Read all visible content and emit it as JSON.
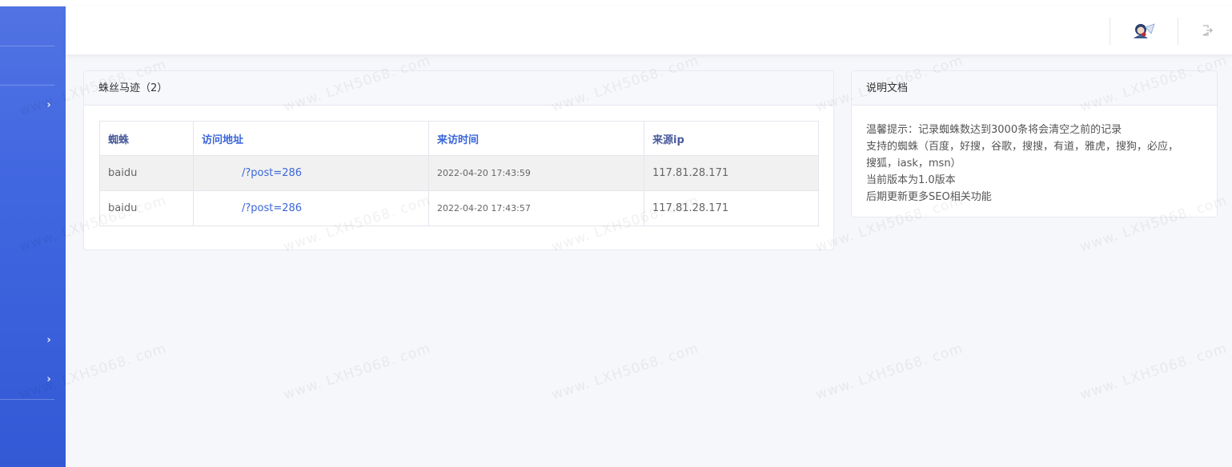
{
  "sidebar": {
    "chevrons": [
      "chevron-right-icon",
      "chevron-right-icon",
      "chevron-right-icon"
    ]
  },
  "header": {
    "avatar_icon": "user-avatar-icon",
    "logout_icon": "logout-icon"
  },
  "spider_panel": {
    "title": "蛛丝马迹（2）",
    "columns": [
      "蜘蛛",
      "访问地址",
      "来访时间",
      "来源ip"
    ],
    "rows": [
      {
        "spider": "baidu",
        "url": "/?post=286",
        "time": "2022-04-20 17:43:59",
        "ip": "117.81.28.171"
      },
      {
        "spider": "baidu",
        "url": "/?post=286",
        "time": "2022-04-20 17:43:57",
        "ip": "117.81.28.171"
      }
    ]
  },
  "doc_panel": {
    "title": "说明文档",
    "lines": [
      "温馨提示：记录蜘蛛数达到3000条将会清空之前的记录",
      "支持的蜘蛛（百度，好搜，谷歌，搜搜，有道，雅虎，搜狗，必应，",
      "搜狐，iask，msn）",
      "当前版本为1.0版本",
      "后期更新更多SEO相关功能"
    ]
  },
  "watermark": "www. LXH5068. com",
  "colors": {
    "sidebar": "#4066e0",
    "link": "#3a66d8"
  }
}
